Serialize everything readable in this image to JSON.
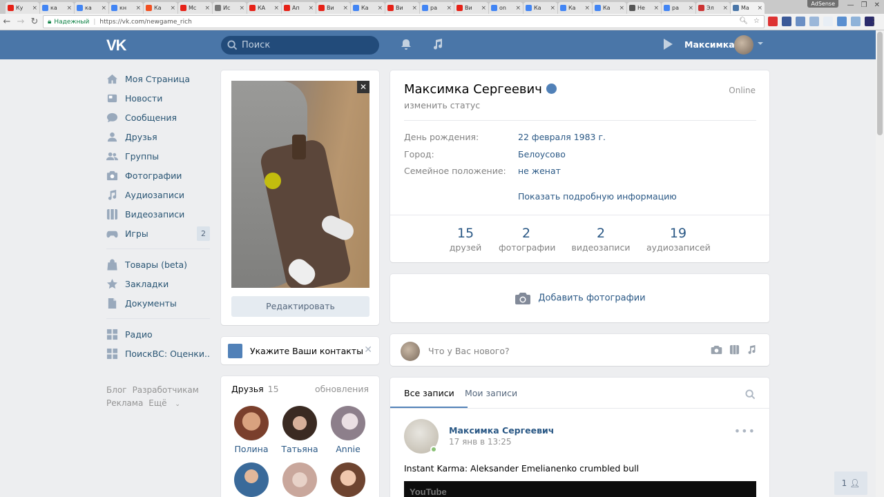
{
  "browser": {
    "tabs": [
      {
        "label": "Ку",
        "color": "#e62117"
      },
      {
        "label": "ка",
        "color": "#4285f4"
      },
      {
        "label": "ка",
        "color": "#4285f4"
      },
      {
        "label": "кн",
        "color": "#4285f4"
      },
      {
        "label": "Ка",
        "color": "#f25022"
      },
      {
        "label": "Мс",
        "color": "#e62117"
      },
      {
        "label": "Ис",
        "color": "#777777"
      },
      {
        "label": "КА",
        "color": "#e62117"
      },
      {
        "label": "Ап",
        "color": "#e62117"
      },
      {
        "label": "Ви",
        "color": "#e62117"
      },
      {
        "label": "Ка",
        "color": "#4285f4"
      },
      {
        "label": "Ви",
        "color": "#e62117"
      },
      {
        "label": "ра",
        "color": "#4285f4"
      },
      {
        "label": "Ви",
        "color": "#e62117"
      },
      {
        "label": "on",
        "color": "#4285f4"
      },
      {
        "label": "Ка",
        "color": "#4285f4"
      },
      {
        "label": "Ка",
        "color": "#4285f4"
      },
      {
        "label": "Ка",
        "color": "#4285f4"
      },
      {
        "label": "Не",
        "color": "#555555"
      },
      {
        "label": "ра",
        "color": "#4285f4"
      },
      {
        "label": "Эл",
        "color": "#cc3333"
      },
      {
        "label": "Ма",
        "color": "#4a76a8"
      }
    ],
    "adsense": "AdSense",
    "secure_label": "Надежный",
    "url": "https://vk.com/newgame_rich"
  },
  "header": {
    "logo": "VK",
    "search_placeholder": "Поиск",
    "user_name": "Максимка"
  },
  "left_menu": {
    "items": [
      {
        "label": "Моя Страница",
        "icon": "home-icon"
      },
      {
        "label": "Новости",
        "icon": "news-icon"
      },
      {
        "label": "Сообщения",
        "icon": "messages-icon"
      },
      {
        "label": "Друзья",
        "icon": "friends-icon"
      },
      {
        "label": "Группы",
        "icon": "groups-icon"
      },
      {
        "label": "Фотографии",
        "icon": "photos-icon"
      },
      {
        "label": "Аудиозаписи",
        "icon": "music-icon"
      },
      {
        "label": "Видеозаписи",
        "icon": "video-icon"
      },
      {
        "label": "Игры",
        "icon": "games-icon",
        "badge": "2"
      }
    ],
    "items2": [
      {
        "label": "Товары (beta)",
        "icon": "bag-icon"
      },
      {
        "label": "Закладки",
        "icon": "star-icon"
      },
      {
        "label": "Документы",
        "icon": "doc-icon"
      }
    ],
    "items3": [
      {
        "label": "Радио",
        "icon": "app-icon"
      },
      {
        "label": "ПоискВС: Оценки..",
        "icon": "app-icon"
      }
    ],
    "footer": [
      "Блог",
      "Разработчикам",
      "Реклама",
      "Ещё"
    ]
  },
  "profile": {
    "edit_button": "Редактировать",
    "name": "Максимка Сергеевич",
    "status": "изменить статус",
    "online": "Online",
    "info": [
      {
        "key": "День рождения:",
        "value": "22 февраля 1983 г."
      },
      {
        "key": "Город:",
        "value": "Белоусово"
      },
      {
        "key": "Семейное положение:",
        "value": "не женат"
      }
    ],
    "more_info": "Показать подробную информацию",
    "counters": [
      {
        "num": "15",
        "label": "друзей"
      },
      {
        "num": "2",
        "label": "фотографии"
      },
      {
        "num": "2",
        "label": "видеозаписи"
      },
      {
        "num": "19",
        "label": "аудиозаписей"
      }
    ]
  },
  "add_photo": "Добавить фотографии",
  "contacts": {
    "text": "Укажите Ваши контакты",
    "close": "✕"
  },
  "friends": {
    "title": "Друзья",
    "count": "15",
    "updates": "обновления",
    "list": [
      {
        "name": "Полина",
        "color": "#7a3f2c"
      },
      {
        "name": "Татьяна",
        "color": "#3a2a22"
      },
      {
        "name": "Annie",
        "color": "#c9c0c6"
      }
    ],
    "list2": [
      {
        "color": "#3a6a9a"
      },
      {
        "color": "#c9a79c"
      },
      {
        "color": "#d9a890"
      }
    ]
  },
  "wall": {
    "placeholder": "Что у Вас нового?",
    "tab_all": "Все записи",
    "tab_mine": "Мои записи"
  },
  "post": {
    "author": "Максимка Сергеевич",
    "date": "17 янв в 13:25",
    "dots": "•••",
    "text": "Instant Karma: Aleksander Emelianenko crumbled bull",
    "video_logo": "YouTube"
  },
  "chat": {
    "count": "1"
  }
}
